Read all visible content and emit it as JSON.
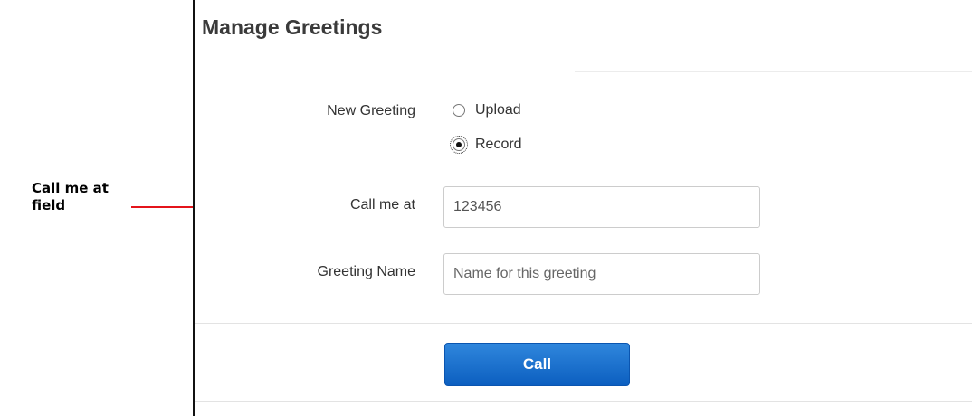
{
  "callout": {
    "label": "Call me at field",
    "color": "#e4141b"
  },
  "panel": {
    "title": "Manage Greetings"
  },
  "form": {
    "new_greeting_label": "New Greeting",
    "options": [
      {
        "label": "Upload",
        "selected": false
      },
      {
        "label": "Record",
        "selected": true
      }
    ],
    "call_me_label": "Call me at",
    "call_me_value": "123456",
    "greeting_name_label": "Greeting Name",
    "greeting_name_placeholder": "Name for this greeting"
  },
  "actions": {
    "call_label": "Call",
    "call_color": "#1a6fd0"
  }
}
